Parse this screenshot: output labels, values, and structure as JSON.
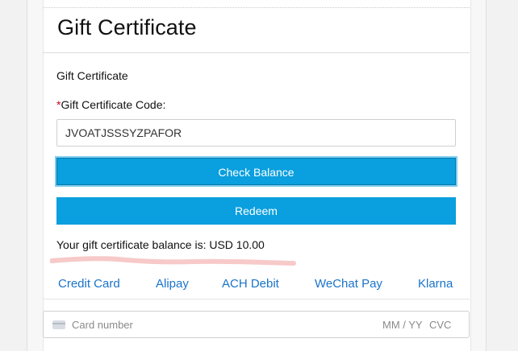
{
  "page": {
    "heading": "Gift Certificate"
  },
  "gift_certificate": {
    "section_label": "Gift Certificate",
    "required_marker": "*",
    "code_label": "Gift Certificate Code:",
    "code_value": "JVOATJSSSYZPAFOR",
    "check_balance_label": "Check Balance",
    "redeem_label": "Redeem",
    "balance_text": "Your gift certificate balance is: USD 10.00"
  },
  "payment_methods": {
    "tabs": [
      {
        "label": "Credit Card"
      },
      {
        "label": "Alipay"
      },
      {
        "label": "ACH Debit"
      },
      {
        "label": "WeChat Pay"
      },
      {
        "label": "Klarna"
      }
    ]
  },
  "card_form": {
    "card_number_placeholder": "Card number",
    "expiry_placeholder": "MM / YY",
    "cvc_placeholder": "CVC",
    "icon": "credit-card-icon"
  },
  "colors": {
    "button": "#0a9fde",
    "link": "#1a73c9",
    "required": "#d0021b",
    "highlight": "#f7c9c9"
  }
}
